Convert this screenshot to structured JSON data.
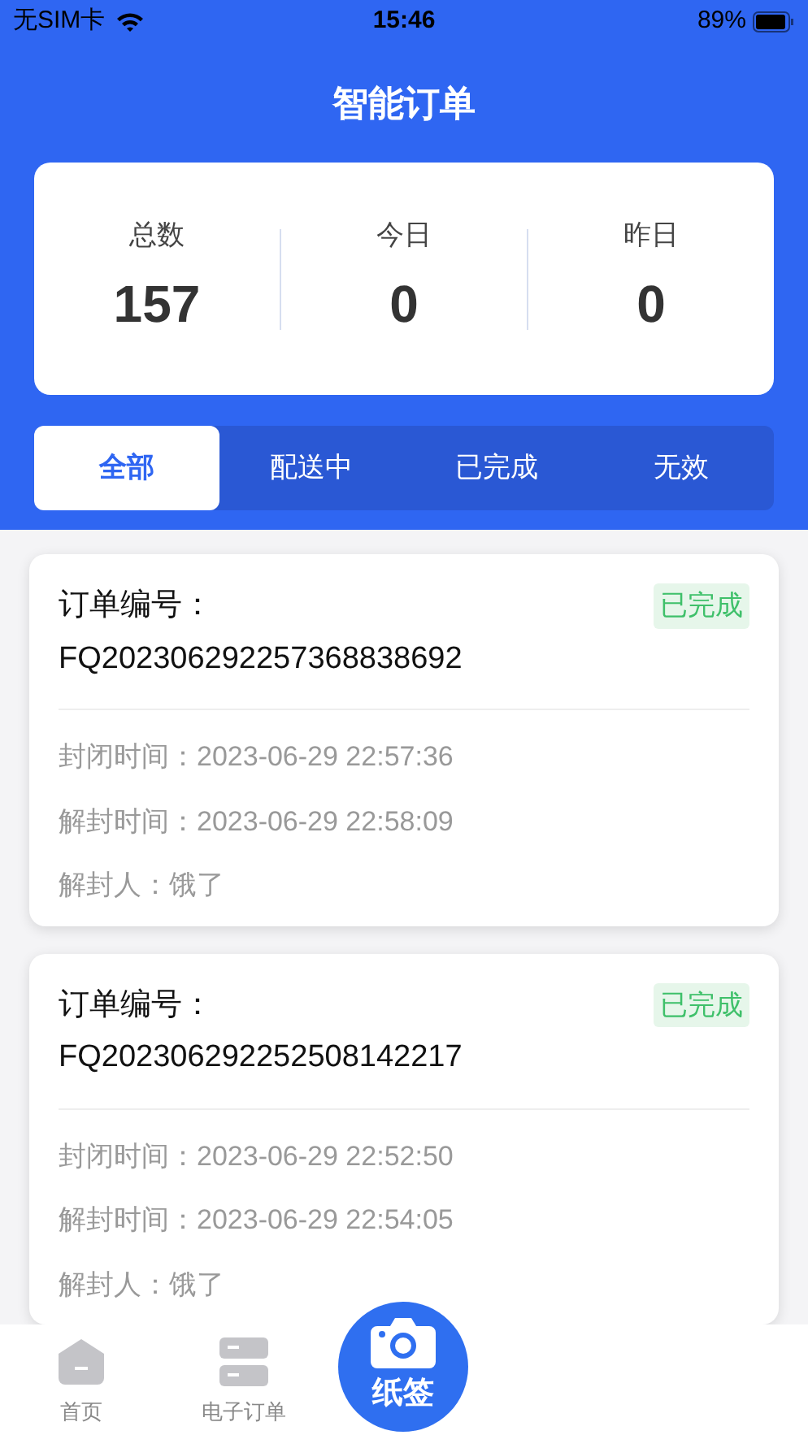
{
  "status_bar": {
    "carrier": "无SIM卡",
    "time": "15:46",
    "battery": "89%"
  },
  "header": {
    "title": "智能订单"
  },
  "stats": [
    {
      "label": "总数",
      "value": "157"
    },
    {
      "label": "今日",
      "value": "0"
    },
    {
      "label": "昨日",
      "value": "0"
    }
  ],
  "tabs": [
    {
      "label": "全部",
      "selected": true
    },
    {
      "label": "配送中",
      "selected": false
    },
    {
      "label": "已完成",
      "selected": false
    },
    {
      "label": "无效",
      "selected": false
    }
  ],
  "orders": [
    {
      "number_label": "订单编号：",
      "number": "FQ202306292257368838692",
      "status": "已完成",
      "fields": [
        "封闭时间：2023-06-29 22:57:36",
        "解封时间：2023-06-29 22:58:09",
        "解封人：饿了"
      ]
    },
    {
      "number_label": "订单编号：",
      "number": "FQ202306292252508142217",
      "status": "已完成",
      "fields": [
        "封闭时间：2023-06-29 22:52:50",
        "解封时间：2023-06-29 22:54:05",
        "解封人：饿了"
      ]
    }
  ],
  "bottom_nav": [
    {
      "label": "首页",
      "kind": "home"
    },
    {
      "label": "电子订单",
      "kind": "list"
    },
    {
      "label": "纸签",
      "kind": "camera"
    }
  ]
}
